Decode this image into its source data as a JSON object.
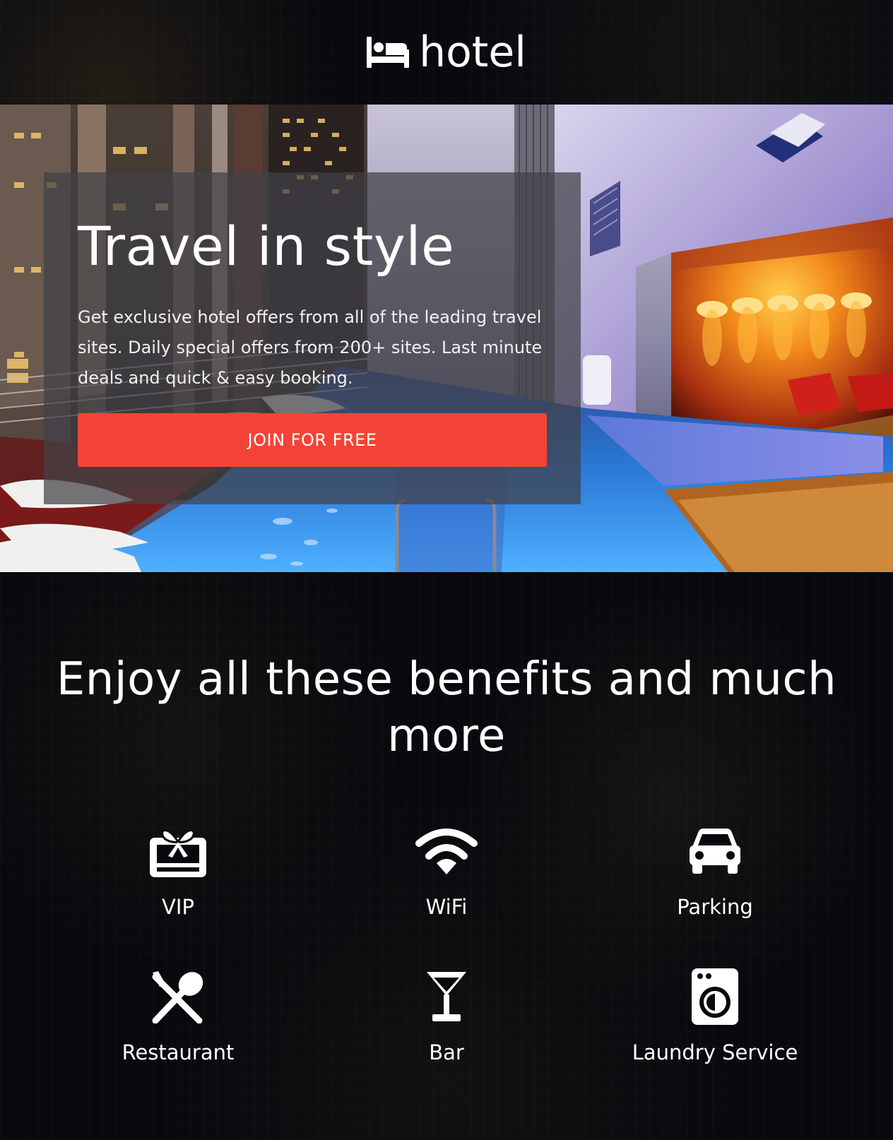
{
  "header": {
    "logo_text": "hotel",
    "logo_icon": "bed-icon"
  },
  "hero": {
    "title": "Travel in style",
    "description": "Get exclusive hotel offers from all of the leading travel sites. Daily special offers from 200+ sites. Last minute deals and quick & easy booking.",
    "cta_label": "JOIN FOR FREE",
    "image": "rooftop-pool-photo"
  },
  "benefits": {
    "heading": "Enjoy all these benefits and much more",
    "items": [
      {
        "label": "VIP",
        "icon": "gift-card-icon"
      },
      {
        "label": "WiFi",
        "icon": "wifi-icon"
      },
      {
        "label": "Parking",
        "icon": "car-icon"
      },
      {
        "label": "Restaurant",
        "icon": "restaurant-icon"
      },
      {
        "label": "Bar",
        "icon": "cocktail-glass-icon"
      },
      {
        "label": "Laundry Service",
        "icon": "washing-machine-icon"
      }
    ]
  },
  "colors": {
    "accent": "#f44336",
    "background": "#07090d",
    "panel": "rgba(65,65,70,0.72)",
    "text": "#ffffff"
  }
}
